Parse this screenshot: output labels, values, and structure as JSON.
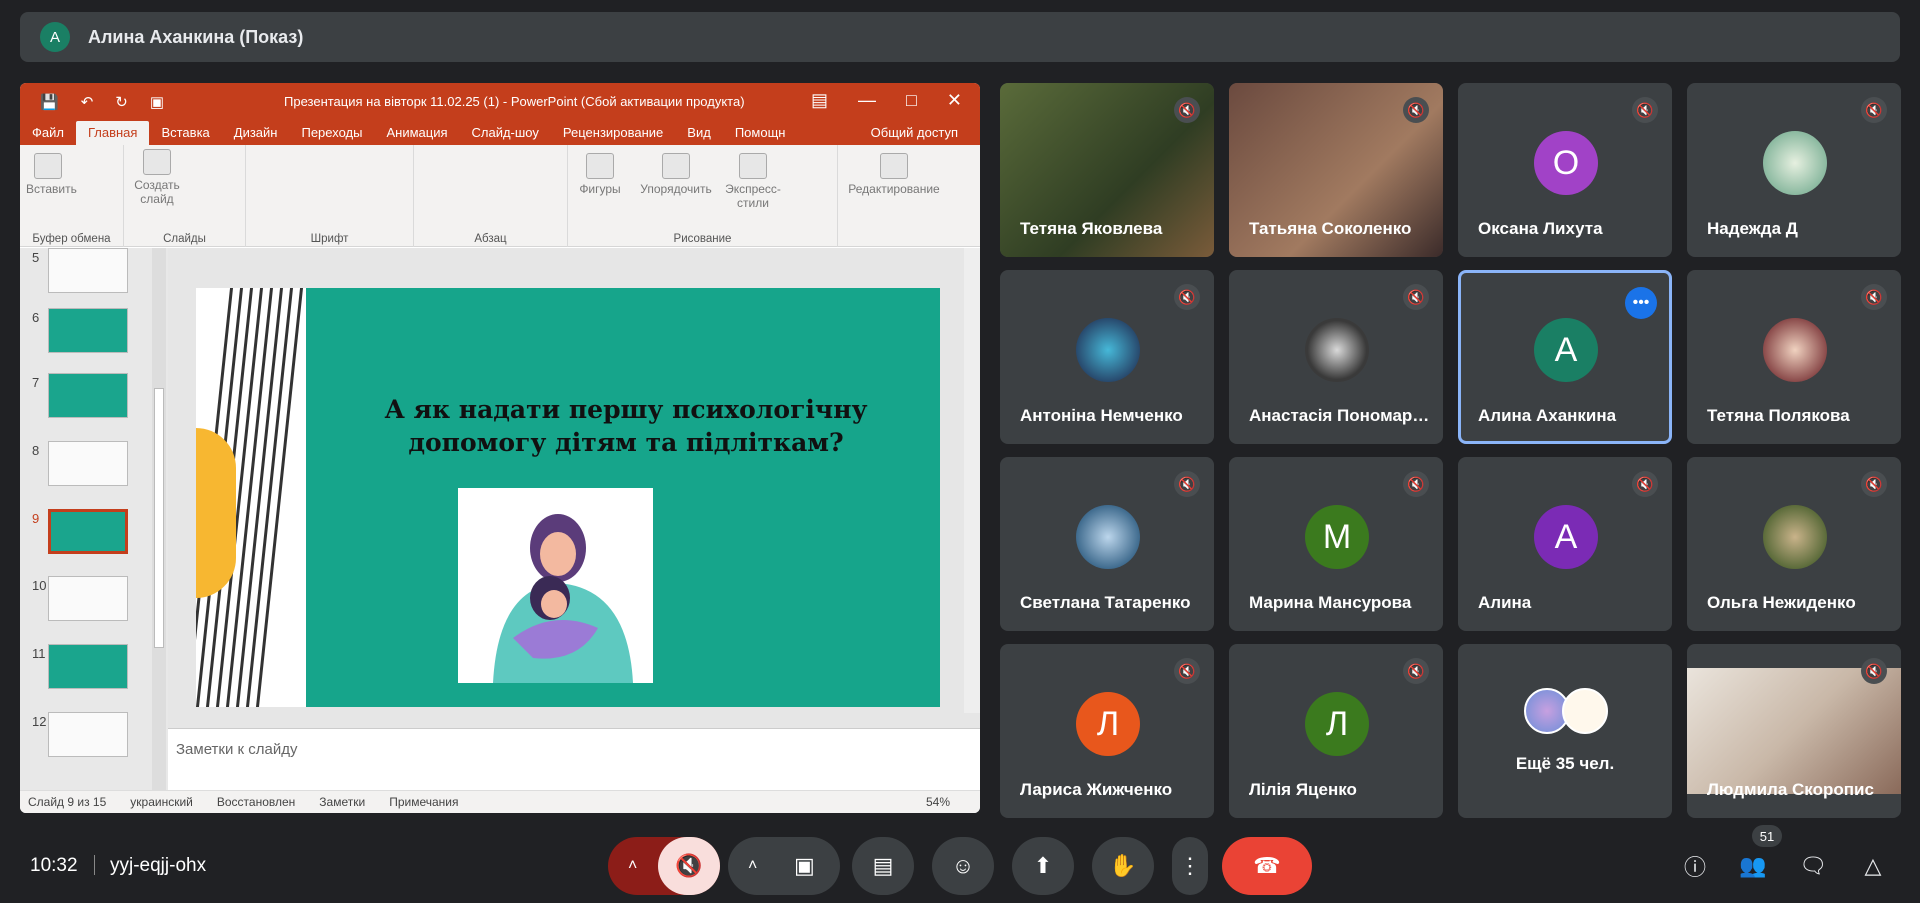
{
  "presenter": {
    "avatar_letter": "А",
    "label": "Алина Аханкина (Показ)"
  },
  "ppt": {
    "window_title": "Презентация на вівторк 11.02.25 (1) - PowerPoint (Сбой активации продукта)",
    "tabs": [
      "Файл",
      "Главная",
      "Вставка",
      "Дизайн",
      "Переходы",
      "Анимация",
      "Слайд-шоу",
      "Рецензирование",
      "Вид",
      "Помощн"
    ],
    "share_label": "Общий доступ",
    "ribbon": {
      "paste": "Вставить",
      "new_slide": "Создать слайд",
      "shapes": "Фигуры",
      "arrange": "Упорядочить",
      "express": "Экспресс-стили",
      "editing": "Редактирование",
      "groups": [
        "Буфер обмена",
        "Слайды",
        "Шрифт",
        "Абзац",
        "Рисование"
      ]
    },
    "thumb_numbers": [
      "5",
      "6",
      "7",
      "8",
      "9",
      "10",
      "11",
      "12"
    ],
    "slide_title": "А як надати першу психологічну допомогу дітям та підліткам?",
    "notes_placeholder": "Заметки к слайду",
    "status": {
      "slide": "Слайд 9 из 15",
      "lang": "украинский",
      "recovered": "Восстановлен",
      "notes": "Заметки",
      "comments": "Примечания",
      "zoom": "54%"
    }
  },
  "participants": [
    {
      "name": "Тетяна Яковлева",
      "kind": "video"
    },
    {
      "name": "Татьяна Соколенко",
      "kind": "video"
    },
    {
      "name": "Оксана Лихута",
      "kind": "letter",
      "letter": "О",
      "color": "#a142c7"
    },
    {
      "name": "Надежда Д",
      "kind": "photo"
    },
    {
      "name": "Антоніна Немченко",
      "kind": "photo"
    },
    {
      "name": "Анастасія Пономаренко",
      "kind": "photo"
    },
    {
      "name": "Алина Аханкина",
      "kind": "letter",
      "letter": "А",
      "color": "#1a7f64",
      "selected": true
    },
    {
      "name": "Тетяна Полякова",
      "kind": "photo"
    },
    {
      "name": "Светлана Татаренко",
      "kind": "photo"
    },
    {
      "name": "Марина Мансурова",
      "kind": "letter",
      "letter": "М",
      "color": "#3b7a1e"
    },
    {
      "name": "Алина",
      "kind": "letter",
      "letter": "А",
      "color": "#7b2bb5"
    },
    {
      "name": "Ольга Нежиденко",
      "kind": "photo"
    },
    {
      "name": "Лариса Жижченко",
      "kind": "letter",
      "letter": "Л",
      "color": "#e8571c"
    },
    {
      "name": "Лілія Яценко",
      "kind": "letter",
      "letter": "Л",
      "color": "#3b7a1e"
    },
    {
      "name": "Ещё 35 чел.",
      "kind": "more"
    },
    {
      "name": "Людмила Скоропис",
      "kind": "video"
    }
  ],
  "bottom": {
    "time": "10:32",
    "meeting_code": "yyj-eqjj-ohx",
    "people_count": "51"
  }
}
